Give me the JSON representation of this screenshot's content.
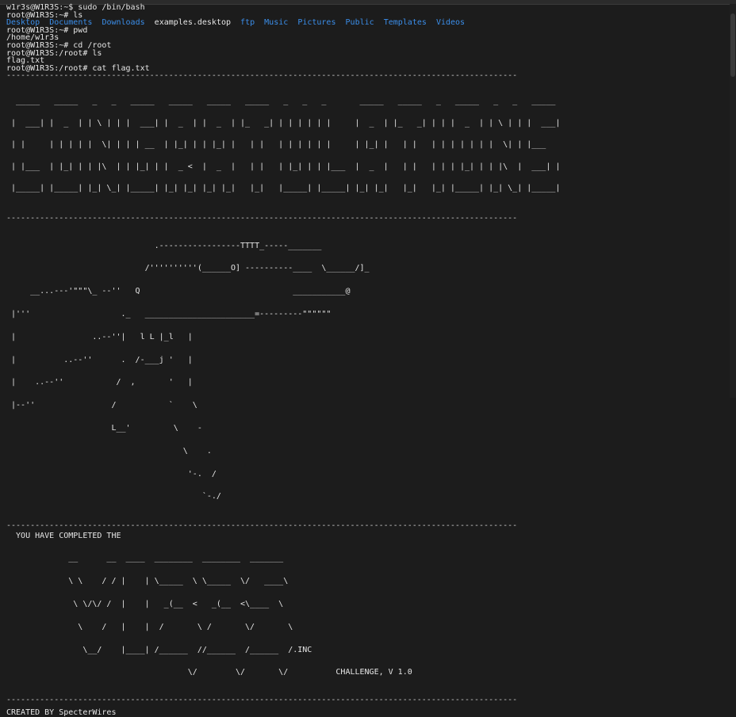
{
  "terminal": {
    "lines": [
      "w1r3s@W1R3S:~$ sudo /bin/bash",
      "root@W1R3S:~# ls"
    ],
    "ls_output": [
      "Desktop",
      "Documents",
      "Downloads",
      "examples.desktop",
      "ftp",
      "Music",
      "Pictures",
      "Public",
      "Templates",
      "Videos"
    ],
    "lines2": [
      "root@W1R3S:~# pwd",
      "/home/w1r3s",
      "root@W1R3S:~# cd /root",
      "root@W1R3S:/root# ls",
      "flag.txt",
      "root@W1R3S:/root# cat flag.txt"
    ],
    "separator": "-----------------------------------------------------------------------------------------------------------",
    "congrats_art": [
      "  _____   _____   _   _   _____   _____   _____   _____   _   _   _       _____   _____   _   _____   _   _   _____ ",
      " |  ___| |  _  | | \\ | | |  ___| |  _  | |  _  | |_   _| | | | | | |     |  _  | |_   _| | | |  _  | | \\ | | |  ___|",
      " | |     | | | | |  \\| | | | __  | |_| | | |_| |   | |   | | | | | |     | |_| |   | |   | | | | | | |  \\| | |___  ",
      " | |___  | |_| | | |\\  | | |_| | |  _ <  |  _  |   | |   | |_| | | |___  |  _  |   | |   | | | |_| | | |\\  |  ___| |",
      " |_____| |_____| |_| \\_| |_____| |_| |_| |_| |_|   |_|   |_____| |_____| |_| |_|   |_|   |_| |_____| |_| \\_| |_____|"
    ],
    "gun_art": [
      "                               .-----------------TTTT_-----_______",
      "                             /''''''''''(______O] ----------____  \\______/]_",
      "     __...---'\"\"\"\\_ --''   Q                                ___________@",
      " |'''                   ._   _______________________=---------\"\"\"\"\"\"",
      " |                ..--''|   l L |_l   |",
      " |          ..--''      .  /-___j '   |",
      " |    ..--''           /  ,       '   |",
      " |--''                /           `    \\",
      "                      L__'         \\    -",
      "                                     \\    .",
      "                                      '-.  /",
      "                                         `-./"
    ],
    "completed_text": "  YOU HAVE COMPLETED THE",
    "wires_art": [
      "             __      __  ____  ________  ________  _______",
      "             \\ \\    / / |    | \\_____  \\ \\_____  \\/   ____\\",
      "              \\ \\/\\/ /  |    |   _(__  <   _(__  <\\____  \\",
      "               \\    /   |    |  /       \\ /       \\/       \\",
      "                \\__/    |____| /______  //______  /______  /.INC",
      "                                      \\/        \\/       \\/          CHALLENGE, V 1.0"
    ],
    "created_by": "CREATED BY SpecterWires"
  },
  "colors": {
    "background": "#1c1c1c",
    "text": "#e6e6e6",
    "directory": "#3b8eea",
    "accent": "#29b8db"
  }
}
